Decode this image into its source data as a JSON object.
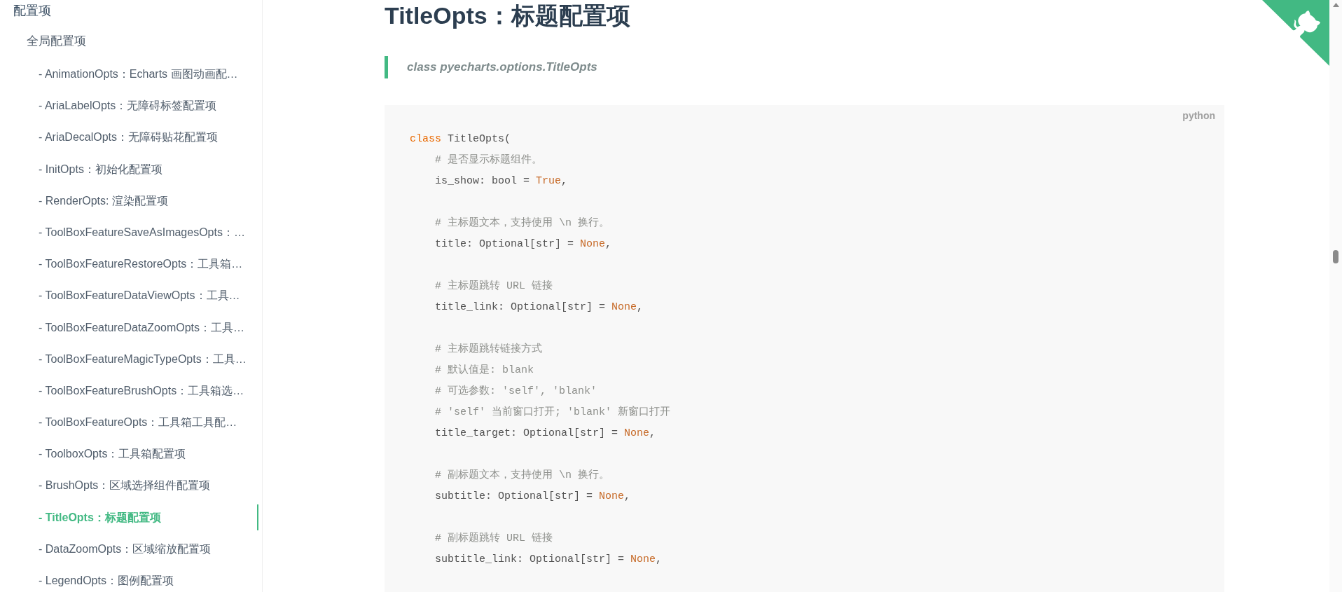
{
  "sidebar": {
    "heading": "配置项",
    "section": "全局配置项",
    "items": [
      {
        "label": "- AnimationOpts：Echarts 画图动画配…",
        "selected": false
      },
      {
        "label": "- AriaLabelOpts：无障碍标签配置项",
        "selected": false
      },
      {
        "label": "- AriaDecalOpts：无障碍贴花配置项",
        "selected": false
      },
      {
        "label": "- InitOpts：初始化配置项",
        "selected": false
      },
      {
        "label": "- RenderOpts: 渲染配置项",
        "selected": false
      },
      {
        "label": "- ToolBoxFeatureSaveAsImagesOpts：…",
        "selected": false
      },
      {
        "label": "- ToolBoxFeatureRestoreOpts：工具箱…",
        "selected": false
      },
      {
        "label": "- ToolBoxFeatureDataViewOpts：工具…",
        "selected": false
      },
      {
        "label": "- ToolBoxFeatureDataZoomOpts：工具…",
        "selected": false
      },
      {
        "label": "- ToolBoxFeatureMagicTypeOpts：工具…",
        "selected": false
      },
      {
        "label": "- ToolBoxFeatureBrushOpts：工具箱选…",
        "selected": false
      },
      {
        "label": "- ToolBoxFeatureOpts：工具箱工具配…",
        "selected": false
      },
      {
        "label": "- ToolboxOpts：工具箱配置项",
        "selected": false
      },
      {
        "label": "- BrushOpts：区域选择组件配置项",
        "selected": false
      },
      {
        "label": "- TitleOpts：标题配置项",
        "selected": true
      },
      {
        "label": "- DataZoomOpts：区域缩放配置项",
        "selected": false
      },
      {
        "label": "- LegendOpts：图例配置项",
        "selected": false
      }
    ]
  },
  "content": {
    "title": "TitleOpts：标题配置项",
    "signature": "class pyecharts.options.TitleOpts",
    "code": {
      "language": "python",
      "lines": [
        {
          "tokens": [
            {
              "kind": "keyword",
              "text": "class"
            },
            {
              "kind": "plain",
              "text": " TitleOpts("
            }
          ],
          "children": [
            {
              "lines": [
                {
                  "tokens": [
                    {
                      "kind": "comment",
                      "text": "# 是否显示标题组件。"
                    }
                  ]
                },
                {
                  "tokens": [
                    {
                      "kind": "plain",
                      "text": "is_show: bool = "
                    },
                    {
                      "kind": "literal",
                      "text": "True"
                    },
                    {
                      "kind": "plain",
                      "text": ","
                    }
                  ]
                }
              ]
            },
            {
              "lines": [
                {
                  "tokens": [
                    {
                      "kind": "comment",
                      "text": "# 主标题文本，支持使用 \\n 换行。"
                    }
                  ]
                },
                {
                  "tokens": [
                    {
                      "kind": "plain",
                      "text": "title: Optional[str] = "
                    },
                    {
                      "kind": "literal",
                      "text": "None"
                    },
                    {
                      "kind": "plain",
                      "text": ","
                    }
                  ]
                }
              ]
            },
            {
              "lines": [
                {
                  "tokens": [
                    {
                      "kind": "comment",
                      "text": "# 主标题跳转 URL 链接"
                    }
                  ]
                },
                {
                  "tokens": [
                    {
                      "kind": "plain",
                      "text": "title_link: Optional[str] = "
                    },
                    {
                      "kind": "literal",
                      "text": "None"
                    },
                    {
                      "kind": "plain",
                      "text": ","
                    }
                  ]
                }
              ]
            },
            {
              "lines": [
                {
                  "tokens": [
                    {
                      "kind": "comment",
                      "text": "# 主标题跳转链接方式"
                    }
                  ]
                },
                {
                  "tokens": [
                    {
                      "kind": "comment",
                      "text": "# 默认值是: blank"
                    }
                  ]
                },
                {
                  "tokens": [
                    {
                      "kind": "comment",
                      "text": "# 可选参数: 'self', 'blank'"
                    }
                  ]
                },
                {
                  "tokens": [
                    {
                      "kind": "comment",
                      "text": "# 'self' 当前窗口打开; 'blank' 新窗口打开"
                    }
                  ]
                },
                {
                  "tokens": [
                    {
                      "kind": "plain",
                      "text": "title_target: Optional[str] = "
                    },
                    {
                      "kind": "literal",
                      "text": "None"
                    },
                    {
                      "kind": "plain",
                      "text": ","
                    }
                  ]
                }
              ]
            },
            {
              "lines": [
                {
                  "tokens": [
                    {
                      "kind": "comment",
                      "text": "# 副标题文本，支持使用 \\n 换行。"
                    }
                  ]
                },
                {
                  "tokens": [
                    {
                      "kind": "plain",
                      "text": "subtitle: Optional[str] = "
                    },
                    {
                      "kind": "literal",
                      "text": "None"
                    },
                    {
                      "kind": "plain",
                      "text": ","
                    }
                  ]
                }
              ]
            },
            {
              "lines": [
                {
                  "tokens": [
                    {
                      "kind": "comment",
                      "text": "# 副标题跳转 URL 链接"
                    }
                  ]
                },
                {
                  "tokens": [
                    {
                      "kind": "plain",
                      "text": "subtitle_link: Optional[str] = "
                    },
                    {
                      "kind": "literal",
                      "text": "None"
                    },
                    {
                      "kind": "plain",
                      "text": ","
                    }
                  ]
                }
              ]
            }
          ]
        }
      ]
    }
  }
}
